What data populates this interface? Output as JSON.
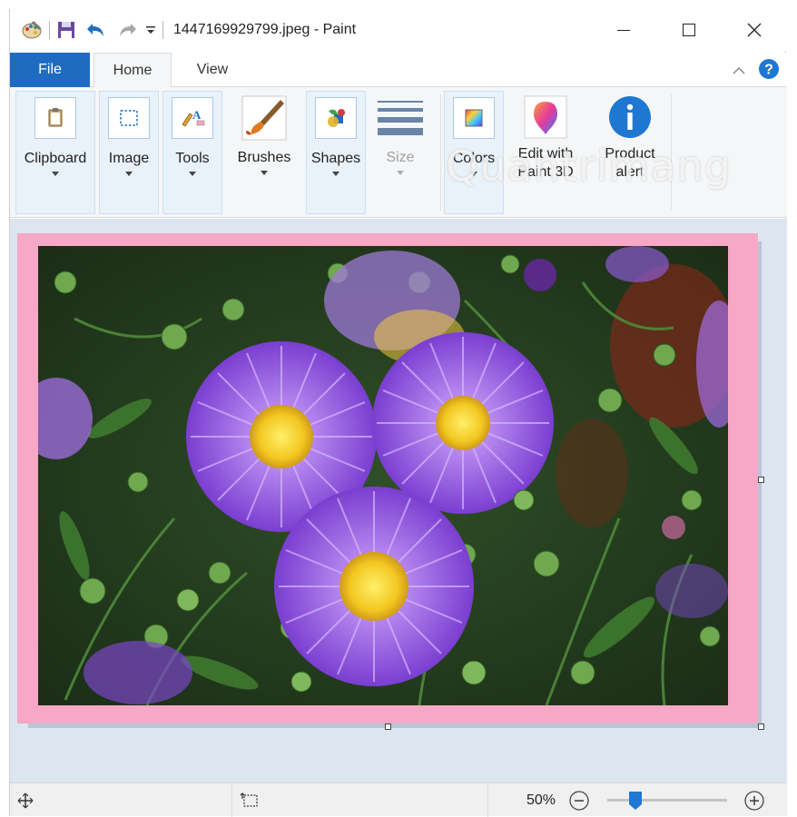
{
  "window": {
    "title": "1447169929799.jpeg - Paint",
    "controls": {
      "minimize": "—",
      "maximize": "☐",
      "close": "✕"
    }
  },
  "quick_access": [
    "paint-app-icon",
    "save-icon",
    "undo-icon",
    "redo-icon",
    "customize-dropdown-icon"
  ],
  "tabs": {
    "file": "File",
    "home": "Home",
    "view": "View",
    "active": "Home"
  },
  "ribbon": {
    "clipboard": "Clipboard",
    "image": "Image",
    "tools": "Tools",
    "brushes": "Brushes",
    "shapes": "Shapes",
    "size": "Size",
    "colors": "Colors",
    "edit_line1": "Edit with",
    "edit_line2": "Paint 3D",
    "product_line1": "Product",
    "product_line2": "alert"
  },
  "watermark": "Quantrimang",
  "canvas": {
    "frame_color": "#f6a8c6",
    "background": "#dce5f0"
  },
  "statusbar": {
    "zoom": "50%",
    "zoom_fraction": 0.25
  },
  "colors": {
    "accent": "#1e6cc2",
    "help": "#1e78d2"
  }
}
